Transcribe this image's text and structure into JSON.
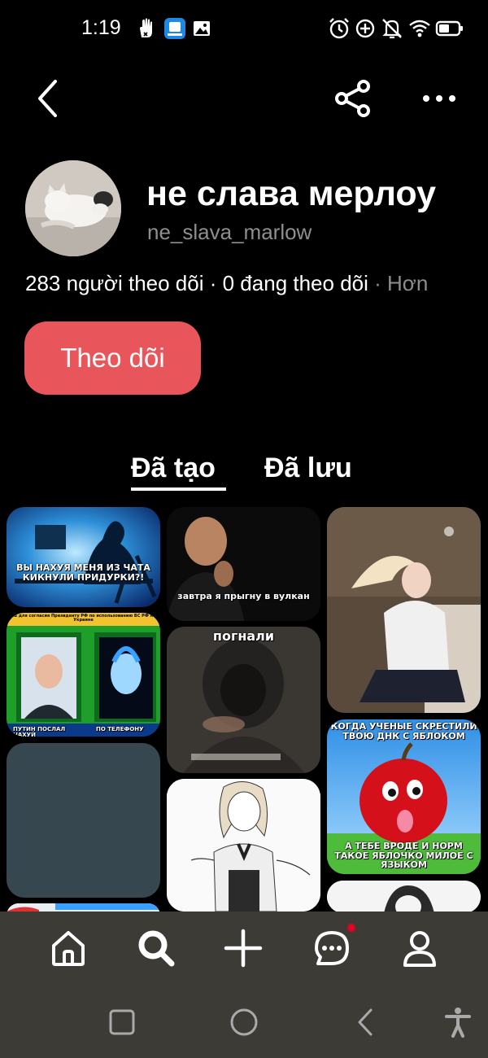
{
  "status_bar": {
    "time": "1:19",
    "left_icons": [
      "hand-icon",
      "app-notification-icon",
      "gallery-icon"
    ],
    "right_icons": [
      "alarm-icon",
      "data-saver-icon",
      "mute-icon",
      "wifi-icon",
      "battery-icon"
    ]
  },
  "top_nav": {
    "back_icon": "chevron-left-icon",
    "share_icon": "share-icon",
    "more_icon": "more-horizontal-icon"
  },
  "profile": {
    "display_name": "не слава мерлоу",
    "username": "ne_slava_marlow",
    "followers": "283 người theo dõi",
    "separator": " · ",
    "following": "0 đang theo dõi",
    "more": " · Hơn",
    "follow_label": "Theo dõi",
    "follow_color": "#e8555a"
  },
  "tabs": [
    {
      "label": "Đã tạo",
      "active": true
    },
    {
      "label": "Đã lưu",
      "active": false
    }
  ],
  "pins": [
    {
      "caption": "ВЫ НАХУЯ МЕНЯ ИЗ ЧАТА КИКНУЛИ ПРИДУРКИ?!"
    },
    {
      "caption_top": "СВ для согласия Президенту РФ по использованию ВС РФ на Украине",
      "caption_bottom_left": "ПУТИН ПОСЛАЛ НАХУЙ",
      "caption_bottom_right": "ПО ТЕЛЕФОНУ"
    },
    {
      "caption": ""
    },
    {
      "caption": "завтра я прыгну в вулкан"
    },
    {
      "caption": "погнали"
    },
    {
      "caption": ""
    },
    {
      "caption": ""
    },
    {
      "caption_top": "КОГДА УЧЕНЫЕ СКРЕСТИЛИ ТВОЮ ДНК С ЯБЛОКОМ",
      "caption_bottom": "А ТЕБЕ ВРОДЕ И НОРМ ТАКОЕ ЯБЛОЧКО МИЛОЕ С ЯЗЫКОМ"
    },
    {
      "caption": ""
    }
  ],
  "bottom_nav": {
    "items": [
      "home-icon",
      "search-icon",
      "plus-icon",
      "messages-icon",
      "profile-icon"
    ],
    "notification_dot_color": "#e60023"
  },
  "system_nav": {
    "items": [
      "recent-apps-icon",
      "home-circle-icon",
      "back-icon",
      "accessibility-icon"
    ]
  }
}
